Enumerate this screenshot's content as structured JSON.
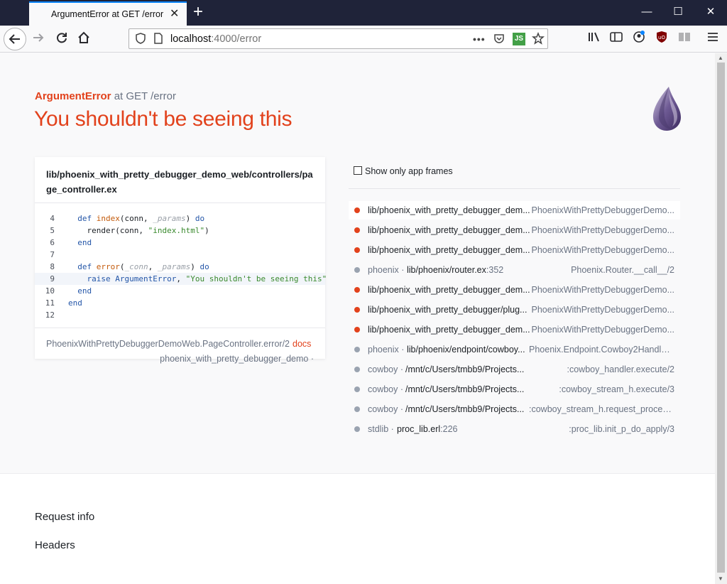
{
  "browser": {
    "tab_title": "ArgumentError at GET /error",
    "tab_close": "✕",
    "new_tab": "+",
    "window_minimize": "—",
    "window_maximize": "☐",
    "window_close": "✕",
    "url_host": "localhost",
    "url_path": ":4000/error",
    "js_badge": "JS",
    "icons": [
      "back-arrow-icon",
      "forward-arrow-icon",
      "reload-icon",
      "home-icon",
      "shield-icon",
      "page-icon",
      "more-icon",
      "pocket-icon",
      "bookmark-star-icon",
      "library-icon",
      "sidebar-icon",
      "account-icon",
      "ublock-icon",
      "reader-icon",
      "menu-icon"
    ]
  },
  "error": {
    "type": "ArgumentError",
    "location": "at GET /error",
    "message": "You shouldn't be seeing this"
  },
  "code": {
    "file": "lib/phoenix_with_pretty_debugger_demo_web/controllers/page_controller.ex",
    "highlight_line": 9,
    "lines": [
      {
        "n": "4",
        "text": "  def index(conn, _params) do"
      },
      {
        "n": "5",
        "text": "    render(conn, \"index.html\")"
      },
      {
        "n": "6",
        "text": "  end"
      },
      {
        "n": "7",
        "text": ""
      },
      {
        "n": "8",
        "text": "  def error(_conn, _params) do"
      },
      {
        "n": "9",
        "text": "    raise ArgumentError, \"You shouldn't be seeing this\""
      },
      {
        "n": "10",
        "text": "  end"
      },
      {
        "n": "11",
        "text": "end"
      },
      {
        "n": "12",
        "text": ""
      }
    ],
    "mfa": "PhoenixWithPrettyDebuggerDemoWeb.PageController.error/2",
    "docs_label": "docs",
    "app": "phoenix_with_pretty_debugger_demo ·"
  },
  "frames": {
    "toggle_label": "Show only app frames",
    "items": [
      {
        "kind": "app",
        "pkg": "",
        "file": "lib/phoenix_with_pretty_debugger_dem...",
        "line": "",
        "mfa": "PhoenixWithPrettyDebuggerDemo...",
        "selected": true
      },
      {
        "kind": "app",
        "pkg": "",
        "file": "lib/phoenix_with_pretty_debugger_dem...",
        "line": "",
        "mfa": "PhoenixWithPrettyDebuggerDemo...",
        "selected": false
      },
      {
        "kind": "app",
        "pkg": "",
        "file": "lib/phoenix_with_pretty_debugger_dem...",
        "line": "",
        "mfa": "PhoenixWithPrettyDebuggerDemo...",
        "selected": false
      },
      {
        "kind": "lib",
        "pkg": "phoenix ·",
        "file": "lib/phoenix/router.ex",
        "line": ":352",
        "mfa": "Phoenix.Router.__call__/2",
        "selected": false
      },
      {
        "kind": "app",
        "pkg": "",
        "file": "lib/phoenix_with_pretty_debugger_dem...",
        "line": "",
        "mfa": "PhoenixWithPrettyDebuggerDemo...",
        "selected": false
      },
      {
        "kind": "app",
        "pkg": "",
        "file": "lib/phoenix_with_pretty_debugger/plug...",
        "line": "",
        "mfa": "PhoenixWithPrettyDebuggerDemo...",
        "selected": false
      },
      {
        "kind": "app",
        "pkg": "",
        "file": "lib/phoenix_with_pretty_debugger_dem...",
        "line": "",
        "mfa": "PhoenixWithPrettyDebuggerDemo...",
        "selected": false
      },
      {
        "kind": "lib",
        "pkg": "phoenix ·",
        "file": "lib/phoenix/endpoint/cowboy...",
        "line": "",
        "mfa": "Phoenix.Endpoint.Cowboy2Handler...",
        "selected": false
      },
      {
        "kind": "lib",
        "pkg": "cowboy ·",
        "file": "/mnt/c/Users/tmbb9/Projects...",
        "line": "",
        "mfa": ":cowboy_handler.execute/2",
        "selected": false
      },
      {
        "kind": "lib",
        "pkg": "cowboy ·",
        "file": "/mnt/c/Users/tmbb9/Projects...",
        "line": "",
        "mfa": ":cowboy_stream_h.execute/3",
        "selected": false
      },
      {
        "kind": "lib",
        "pkg": "cowboy ·",
        "file": "/mnt/c/Users/tmbb9/Projects...",
        "line": "",
        "mfa": ":cowboy_stream_h.request_process/3",
        "selected": false
      },
      {
        "kind": "lib",
        "pkg": "stdlib ·",
        "file": "proc_lib.erl",
        "line": ":226",
        "mfa": ":proc_lib.init_p_do_apply/3",
        "selected": false
      }
    ]
  },
  "sections": {
    "request_info": "Request info",
    "headers": "Headers"
  },
  "colors": {
    "accent": "#e2421c",
    "muted": "#6a7383",
    "titlebar": "#1f2339"
  }
}
